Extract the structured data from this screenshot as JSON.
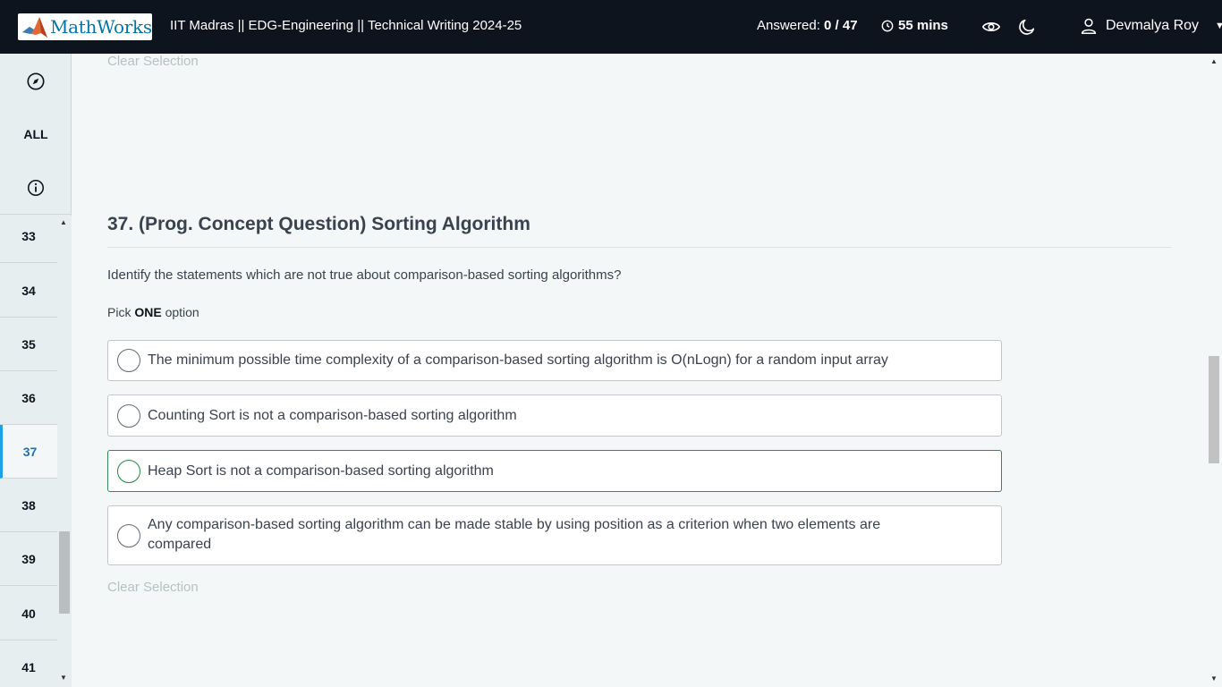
{
  "header": {
    "logo_text": "MathWorks",
    "test_title": "IIT Madras || EDG-Engineering || Technical Writing 2024-25",
    "answered_label": "Answered:",
    "answered_value": "0 / 47",
    "timer": "55 mins",
    "user_name": "Devmalya Roy",
    "icons": [
      "clock-icon",
      "eye-icon",
      "moon-icon",
      "user-icon",
      "caret-down-icon"
    ]
  },
  "sidebar": {
    "all_label": "ALL",
    "icons": [
      "compass-icon",
      "info-icon"
    ],
    "questions": [
      "33",
      "34",
      "35",
      "36",
      "37",
      "38",
      "39",
      "40",
      "41"
    ],
    "active_question": "37"
  },
  "main": {
    "clear_selection_top": "Clear Selection",
    "question_title": "37. (Prog. Concept Question) Sorting Algorithm",
    "question_text": "Identify the statements which are not true about comparison-based sorting algorithms?",
    "pick_prefix": "Pick ",
    "pick_emph": "ONE",
    "pick_suffix": " option",
    "options": [
      "The minimum possible time complexity of a comparison-based sorting algorithm is O(nLogn) for a random input array",
      "Counting Sort is not a comparison-based sorting algorithm",
      "Heap Sort is not a comparison-based sorting algorithm",
      "Any comparison-based sorting algorithm can be made stable by using position as a criterion when two elements are compared"
    ],
    "clear_selection_bottom": "Clear Selection"
  },
  "colors": {
    "header_bg": "#0e141e",
    "logo_blue": "#0076a8",
    "active_accent": "#1ba2e5",
    "hover_green": "#1e8a3c"
  }
}
